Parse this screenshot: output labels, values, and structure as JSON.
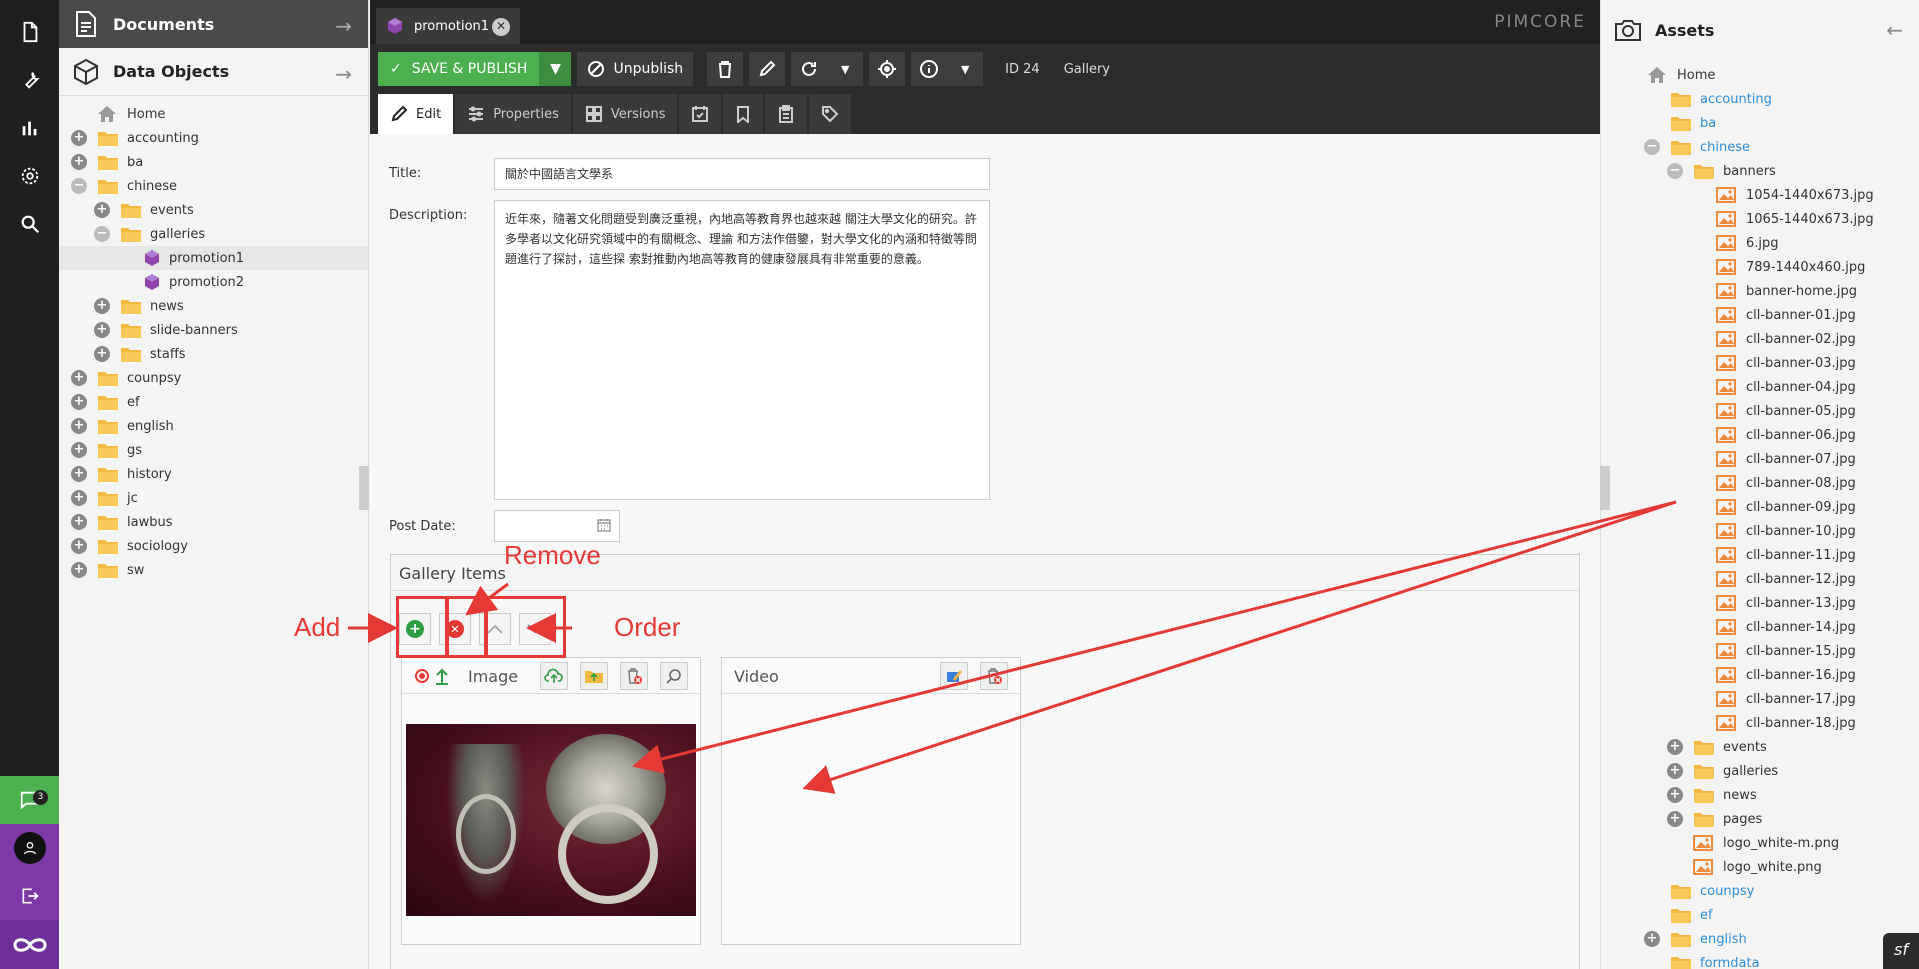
{
  "left_nav": {
    "icons": [
      "file-icon",
      "wrench-icon",
      "bar-chart-icon",
      "gear-icon",
      "search-icon"
    ],
    "notifications_count": "3"
  },
  "left_panel": {
    "documents_title": "Documents",
    "data_objects_title": "Data Objects",
    "tree": [
      {
        "label": "Home",
        "level": 0,
        "toggle": "none",
        "icon": "home"
      },
      {
        "label": "accounting",
        "level": 0,
        "toggle": "plus",
        "icon": "folder"
      },
      {
        "label": "ba",
        "level": 0,
        "toggle": "plus",
        "icon": "folder"
      },
      {
        "label": "chinese",
        "level": 0,
        "toggle": "minus",
        "icon": "folder"
      },
      {
        "label": "events",
        "level": 1,
        "toggle": "plus",
        "icon": "folder"
      },
      {
        "label": "galleries",
        "level": 1,
        "toggle": "minus",
        "icon": "folder"
      },
      {
        "label": "promotion1",
        "level": 2,
        "toggle": "none",
        "icon": "object",
        "selected": true
      },
      {
        "label": "promotion2",
        "level": 2,
        "toggle": "none",
        "icon": "object"
      },
      {
        "label": "news",
        "level": 1,
        "toggle": "plus",
        "icon": "folder"
      },
      {
        "label": "slide-banners",
        "level": 1,
        "toggle": "plus",
        "icon": "folder"
      },
      {
        "label": "staffs",
        "level": 1,
        "toggle": "plus",
        "icon": "folder"
      },
      {
        "label": "counpsy",
        "level": 0,
        "toggle": "plus",
        "icon": "folder"
      },
      {
        "label": "ef",
        "level": 0,
        "toggle": "plus",
        "icon": "folder"
      },
      {
        "label": "english",
        "level": 0,
        "toggle": "plus",
        "icon": "folder"
      },
      {
        "label": "gs",
        "level": 0,
        "toggle": "plus",
        "icon": "folder"
      },
      {
        "label": "history",
        "level": 0,
        "toggle": "plus",
        "icon": "folder"
      },
      {
        "label": "jc",
        "level": 0,
        "toggle": "plus",
        "icon": "folder"
      },
      {
        "label": "lawbus",
        "level": 0,
        "toggle": "plus",
        "icon": "folder"
      },
      {
        "label": "sociology",
        "level": 0,
        "toggle": "plus",
        "icon": "folder"
      },
      {
        "label": "sw",
        "level": 0,
        "toggle": "plus",
        "icon": "folder"
      }
    ]
  },
  "tabbar": {
    "tab_label": "promotion1",
    "brand": "PIMCORE"
  },
  "toolbar": {
    "save_publish": "SAVE & PUBLISH",
    "unpublish": "Unpublish",
    "id_text": "ID 24",
    "class_text": "Gallery"
  },
  "subtabs": {
    "edit": "Edit",
    "properties": "Properties",
    "versions": "Versions"
  },
  "form": {
    "title_label": "Title:",
    "title_value": "關於中國語言文學系",
    "description_label": "Description:",
    "description_value": "近年來，隨著文化問題受到廣泛重視，內地高等教育界也越來越 關注大學文化的研究。許多學者以文化研究領域中的有關概念、理論 和方法作借鑒，對大學文化的內涵和特徵等問題進行了探討，這些探 索對推動內地高等教育的健康發展具有非常重要的意義。",
    "post_date_label": "Post Date:",
    "post_date_value": ""
  },
  "gallery": {
    "title": "Gallery Items",
    "image_label": "Image",
    "video_label": "Video"
  },
  "annotations": {
    "add": "Add",
    "remove": "Remove",
    "order": "Order"
  },
  "assets": {
    "title": "Assets",
    "tree": [
      {
        "label": "Home",
        "level": 0,
        "toggle": "none",
        "icon": "home"
      },
      {
        "label": "accounting",
        "level": 1,
        "toggle": "none",
        "icon": "folder",
        "link": true
      },
      {
        "label": "ba",
        "level": 1,
        "toggle": "none",
        "icon": "folder",
        "link": true
      },
      {
        "label": "chinese",
        "level": 1,
        "toggle": "minus",
        "icon": "folder",
        "link": true
      },
      {
        "label": "banners",
        "level": 2,
        "toggle": "minus",
        "icon": "folder"
      },
      {
        "label": "1054-1440x673.jpg",
        "level": 3,
        "toggle": "none",
        "icon": "image"
      },
      {
        "label": "1065-1440x673.jpg",
        "level": 3,
        "toggle": "none",
        "icon": "image"
      },
      {
        "label": "6.jpg",
        "level": 3,
        "toggle": "none",
        "icon": "image"
      },
      {
        "label": "789-1440x460.jpg",
        "level": 3,
        "toggle": "none",
        "icon": "image"
      },
      {
        "label": "banner-home.jpg",
        "level": 3,
        "toggle": "none",
        "icon": "image"
      },
      {
        "label": "cll-banner-01.jpg",
        "level": 3,
        "toggle": "none",
        "icon": "image"
      },
      {
        "label": "cll-banner-02.jpg",
        "level": 3,
        "toggle": "none",
        "icon": "image"
      },
      {
        "label": "cll-banner-03.jpg",
        "level": 3,
        "toggle": "none",
        "icon": "image"
      },
      {
        "label": "cll-banner-04.jpg",
        "level": 3,
        "toggle": "none",
        "icon": "image"
      },
      {
        "label": "cll-banner-05.jpg",
        "level": 3,
        "toggle": "none",
        "icon": "image"
      },
      {
        "label": "cll-banner-06.jpg",
        "level": 3,
        "toggle": "none",
        "icon": "image"
      },
      {
        "label": "cll-banner-07.jpg",
        "level": 3,
        "toggle": "none",
        "icon": "image"
      },
      {
        "label": "cll-banner-08.jpg",
        "level": 3,
        "toggle": "none",
        "icon": "image"
      },
      {
        "label": "cll-banner-09.jpg",
        "level": 3,
        "toggle": "none",
        "icon": "image"
      },
      {
        "label": "cll-banner-10.jpg",
        "level": 3,
        "toggle": "none",
        "icon": "image"
      },
      {
        "label": "cll-banner-11.jpg",
        "level": 3,
        "toggle": "none",
        "icon": "image"
      },
      {
        "label": "cll-banner-12.jpg",
        "level": 3,
        "toggle": "none",
        "icon": "image"
      },
      {
        "label": "cll-banner-13.jpg",
        "level": 3,
        "toggle": "none",
        "icon": "image"
      },
      {
        "label": "cll-banner-14.jpg",
        "level": 3,
        "toggle": "none",
        "icon": "image"
      },
      {
        "label": "cll-banner-15.jpg",
        "level": 3,
        "toggle": "none",
        "icon": "image"
      },
      {
        "label": "cll-banner-16.jpg",
        "level": 3,
        "toggle": "none",
        "icon": "image"
      },
      {
        "label": "cll-banner-17.jpg",
        "level": 3,
        "toggle": "none",
        "icon": "image"
      },
      {
        "label": "cll-banner-18.jpg",
        "level": 3,
        "toggle": "none",
        "icon": "image"
      },
      {
        "label": "events",
        "level": 2,
        "toggle": "plus",
        "icon": "folder"
      },
      {
        "label": "galleries",
        "level": 2,
        "toggle": "plus",
        "icon": "folder"
      },
      {
        "label": "news",
        "level": 2,
        "toggle": "plus",
        "icon": "folder"
      },
      {
        "label": "pages",
        "level": 2,
        "toggle": "plus",
        "icon": "folder"
      },
      {
        "label": "logo_white-m.png",
        "level": 2,
        "toggle": "none",
        "icon": "image"
      },
      {
        "label": "logo_white.png",
        "level": 2,
        "toggle": "none",
        "icon": "image"
      },
      {
        "label": "counpsy",
        "level": 1,
        "toggle": "none",
        "icon": "folder",
        "link": true
      },
      {
        "label": "ef",
        "level": 1,
        "toggle": "none",
        "icon": "folder",
        "link": true
      },
      {
        "label": "english",
        "level": 1,
        "toggle": "plus",
        "icon": "folder",
        "link": true
      },
      {
        "label": "formdata",
        "level": 1,
        "toggle": "none",
        "icon": "folder",
        "link": true
      }
    ]
  },
  "colors": {
    "accent_green": "#4caf50",
    "accent_purple": "#7d3aa7",
    "annotation_red": "#e53935",
    "folder_yellow": "#f5b942",
    "link_blue": "#2e8fd8"
  }
}
